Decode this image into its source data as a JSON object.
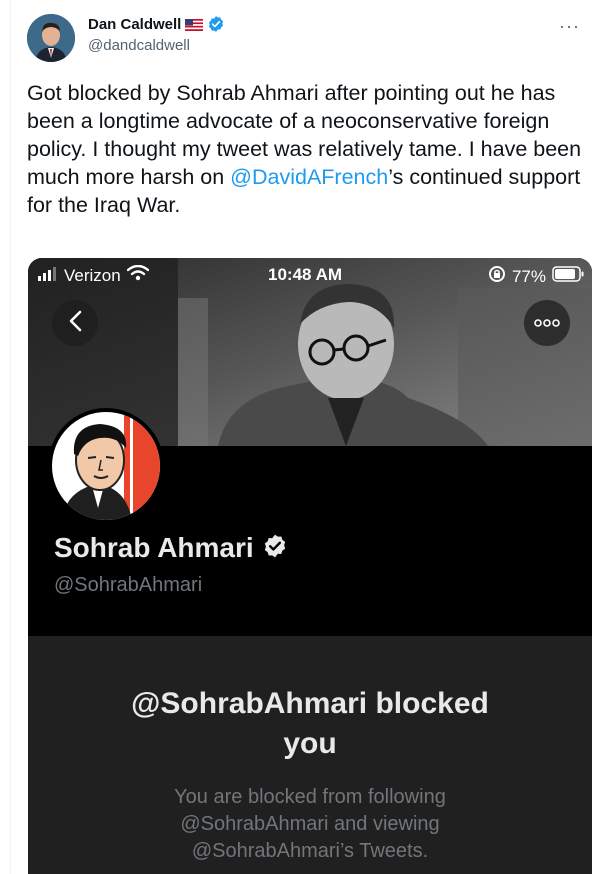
{
  "tweet": {
    "author_name": "Dan Caldwell",
    "author_handle": "@dandcaldwell",
    "text_before_mention": "Got blocked by Sohrab Ahmari after pointing out he has been a longtime  advocate of a neoconservative foreign policy. I thought my tweet was relatively tame. I have been much more harsh on ",
    "mention": "@DavidAFrench",
    "text_after_mention": "’s continued support for the Iraq War.",
    "more_icon": "ellipsis-icon",
    "flag_icon": "us-flag-icon",
    "verified_icon": "verified-badge-icon"
  },
  "screenshot": {
    "status_bar": {
      "carrier": "Verizon",
      "time": "10:48 AM",
      "battery": "77%"
    },
    "profile": {
      "name": "Sohrab Ahmari",
      "handle": "@SohrabAhmari"
    },
    "blocked": {
      "title": "@SohrabAhmari blocked you",
      "body": "You are blocked from following @SohrabAhmari and viewing @SohrabAhmari’s Tweets."
    }
  },
  "colors": {
    "link": "#1d9bf0",
    "text": "#0f1419",
    "muted": "#536471",
    "dark_bg": "#000000",
    "panel_bg": "#202020"
  }
}
